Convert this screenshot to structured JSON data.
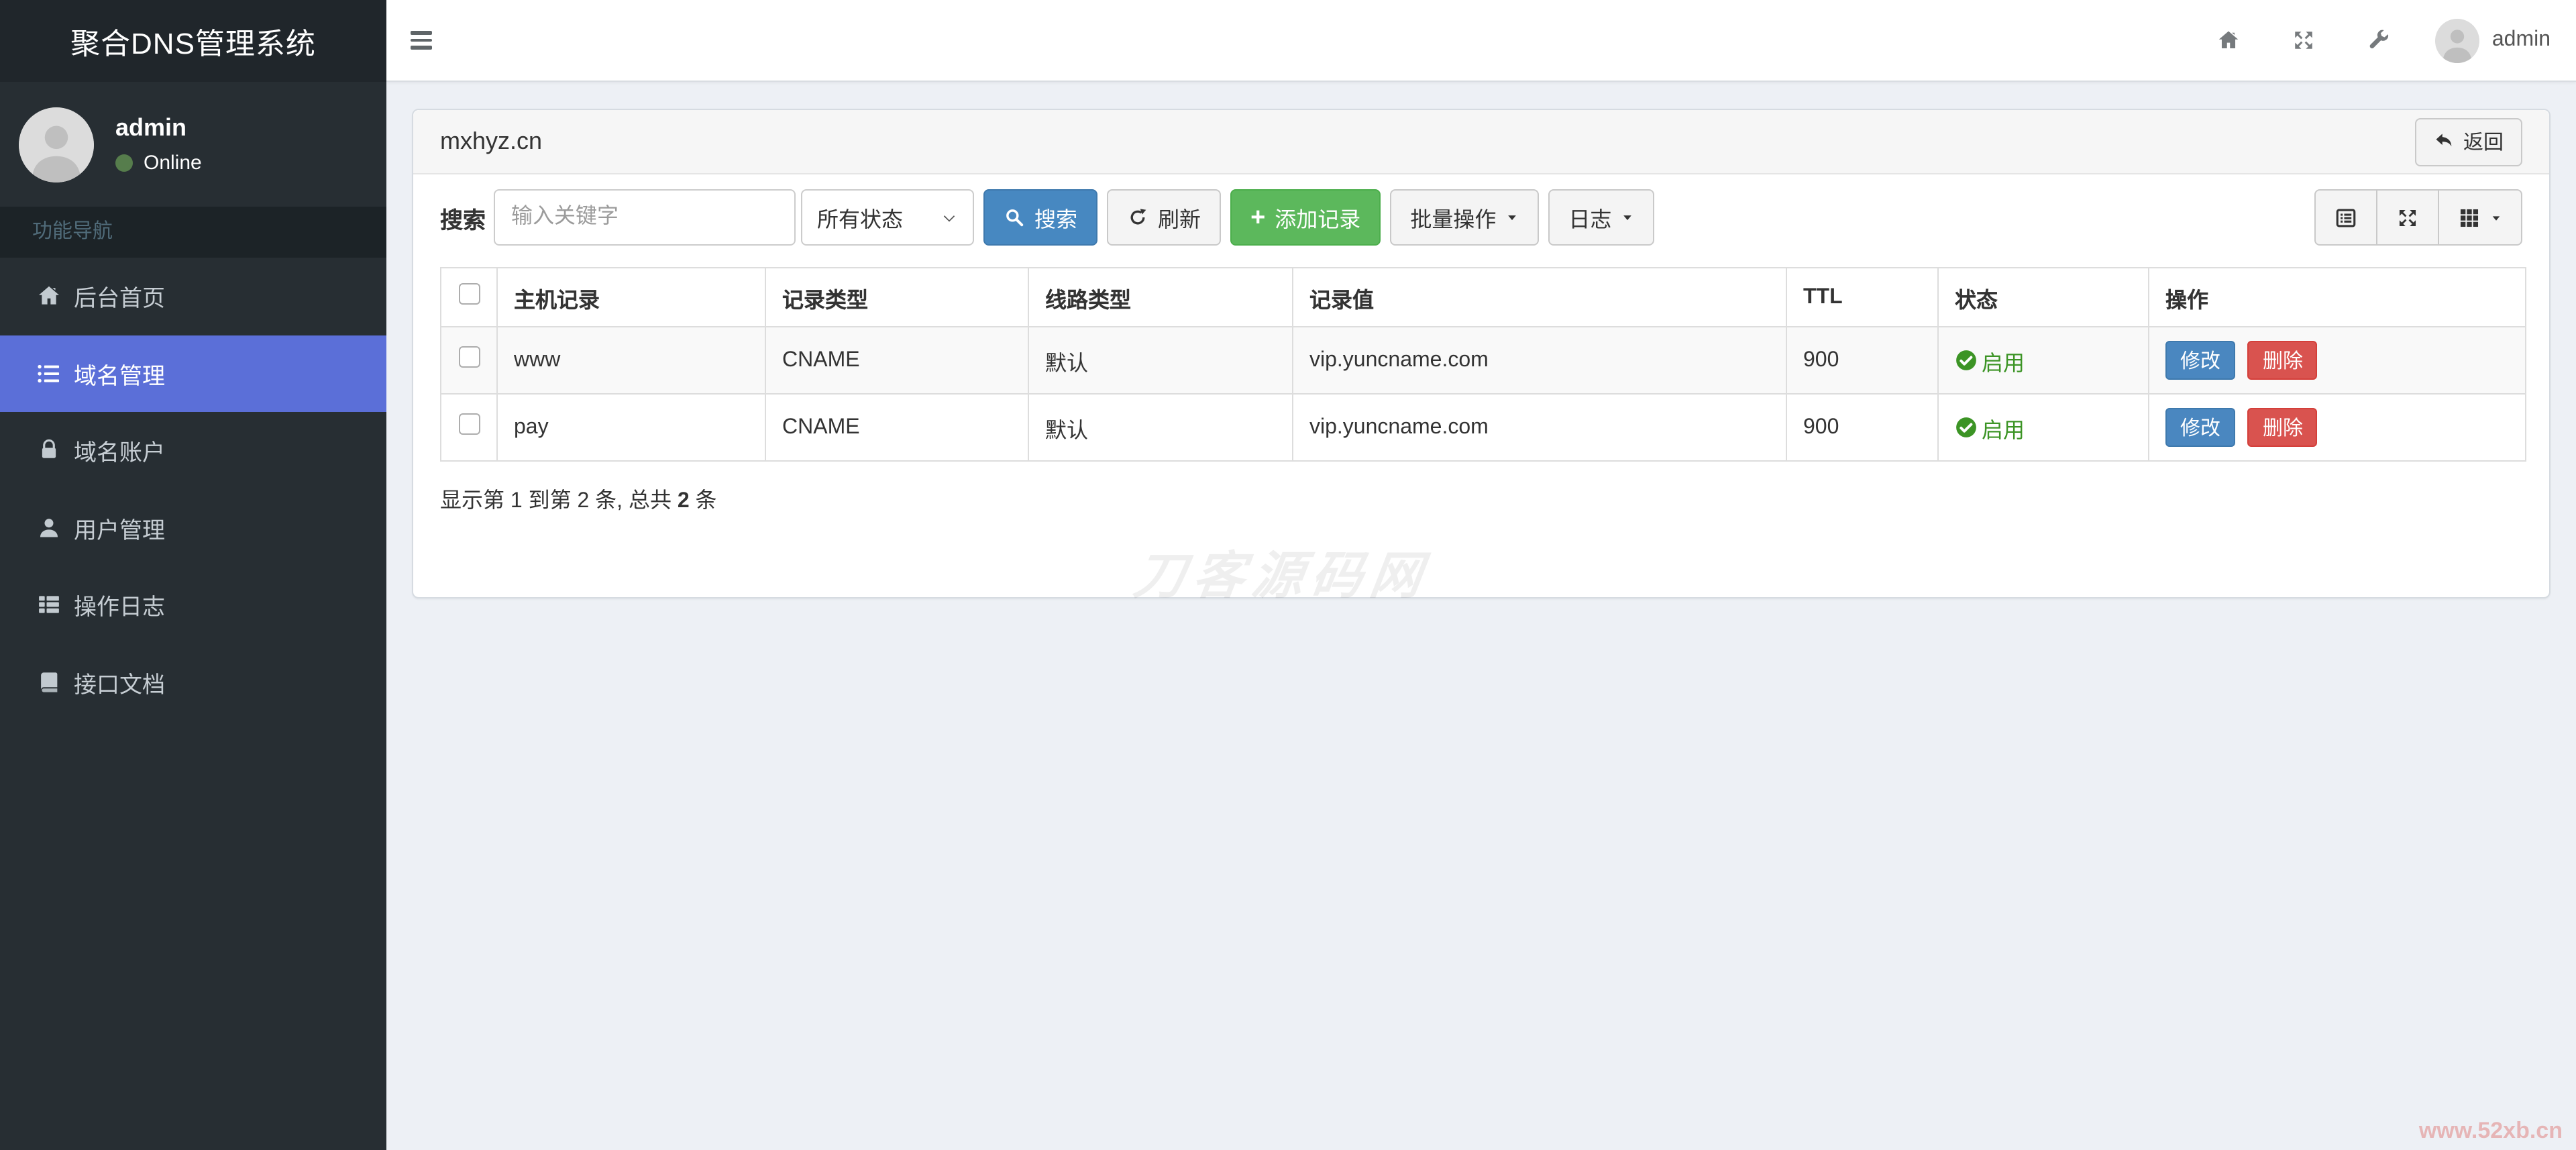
{
  "app": {
    "title": "聚合DNS管理系统"
  },
  "navbar": {
    "user": "admin",
    "icons": [
      "home",
      "fullscreen",
      "wrench"
    ]
  },
  "sidebar": {
    "user": {
      "name": "admin",
      "status": "Online"
    },
    "section_label": "功能导航",
    "items": [
      {
        "label": "后台首页",
        "icon": "home",
        "active": false
      },
      {
        "label": "域名管理",
        "icon": "list-ul",
        "active": true
      },
      {
        "label": "域名账户",
        "icon": "lock",
        "active": false
      },
      {
        "label": "用户管理",
        "icon": "user",
        "active": false
      },
      {
        "label": "操作日志",
        "icon": "th-list",
        "active": false
      },
      {
        "label": "接口文档",
        "icon": "book",
        "active": false
      }
    ]
  },
  "page": {
    "title": "mxhyz.cn",
    "back_label": "返回"
  },
  "toolbar": {
    "search_label": "搜索",
    "keyword_placeholder": "输入关键字",
    "status_filter_value": "所有状态",
    "search_button": "搜索",
    "refresh_button": "刷新",
    "add_button": "添加记录",
    "batch_button": "批量操作",
    "log_button": "日志",
    "view_icons": [
      "detail-view",
      "fullscreen",
      "columns"
    ]
  },
  "table": {
    "columns": [
      "主机记录",
      "记录类型",
      "线路类型",
      "记录值",
      "TTL",
      "状态",
      "操作"
    ],
    "rows": [
      {
        "host": "www",
        "type": "CNAME",
        "line": "默认",
        "value": "vip.yuncname.com",
        "ttl": "900",
        "status": "启用"
      },
      {
        "host": "pay",
        "type": "CNAME",
        "line": "默认",
        "value": "vip.yuncname.com",
        "ttl": "900",
        "status": "启用"
      }
    ],
    "actions": {
      "edit": "修改",
      "delete": "删除"
    }
  },
  "pagination": {
    "prefix": "显示第 1 到第 2 条, 总共 ",
    "total": "2",
    "suffix": " 条"
  },
  "watermark": {
    "center": "刀客源码网",
    "corner": "www.52xb.cn"
  },
  "colors": {
    "sidebar_active": "#5b6fd8",
    "primary_button": "#4788c1",
    "success_button": "#5cb85c",
    "danger_button": "#d9534f",
    "status_enabled_green": "#3c9425",
    "content_bg": "#edf0f5",
    "sidebar_bg": "#272e33"
  }
}
